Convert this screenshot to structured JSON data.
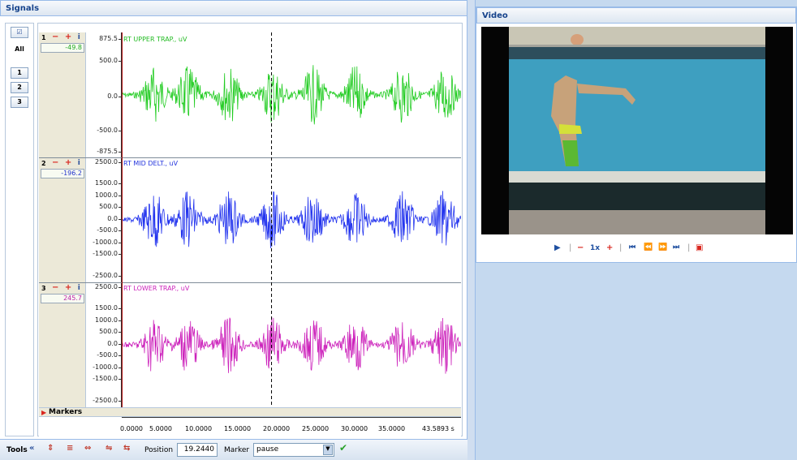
{
  "signals_panel": {
    "title": "Signals"
  },
  "video_panel": {
    "title": "Video"
  },
  "rail": {
    "all_label": "All",
    "channel_buttons": [
      "1",
      "2",
      "3"
    ]
  },
  "channels": [
    {
      "num": "1",
      "value": "-49.8",
      "title": "RT UPPER TRAP., uV",
      "color": "#22cc22",
      "ticks": [
        "875.5",
        "500.0",
        "0.0",
        "-500.0",
        "-875.5"
      ]
    },
    {
      "num": "2",
      "value": "-196.2",
      "title": "RT MID DELT., uV",
      "color": "#2233ee",
      "ticks": [
        "2500.0",
        "1500.0",
        "1000.0",
        "500.0",
        "0.0",
        "-500.0",
        "-1000.0",
        "-1500.0",
        "-2500.0"
      ]
    },
    {
      "num": "3",
      "value": "245.7",
      "title": "RT LOWER TRAP., uV",
      "color": "#cc22bb",
      "ticks": [
        "2500.0",
        "1500.0",
        "1000.0",
        "500.0",
        "0.0",
        "-500.0",
        "-1000.0",
        "-1500.0",
        "-2500.0"
      ]
    }
  ],
  "markers": {
    "label": "Markers"
  },
  "time_axis": {
    "ticks": [
      "0.0000",
      "5.0000",
      "10.0000",
      "15.0000",
      "20.0000",
      "25.0000",
      "30.0000",
      "35.0000",
      "43.5893 s"
    ]
  },
  "toolbar": {
    "tools_label": "Tools",
    "position_label": "Position",
    "position_value": "19.2440",
    "marker_label": "Marker",
    "marker_value": "pause"
  },
  "video_controls": {
    "speed": "1x"
  }
}
